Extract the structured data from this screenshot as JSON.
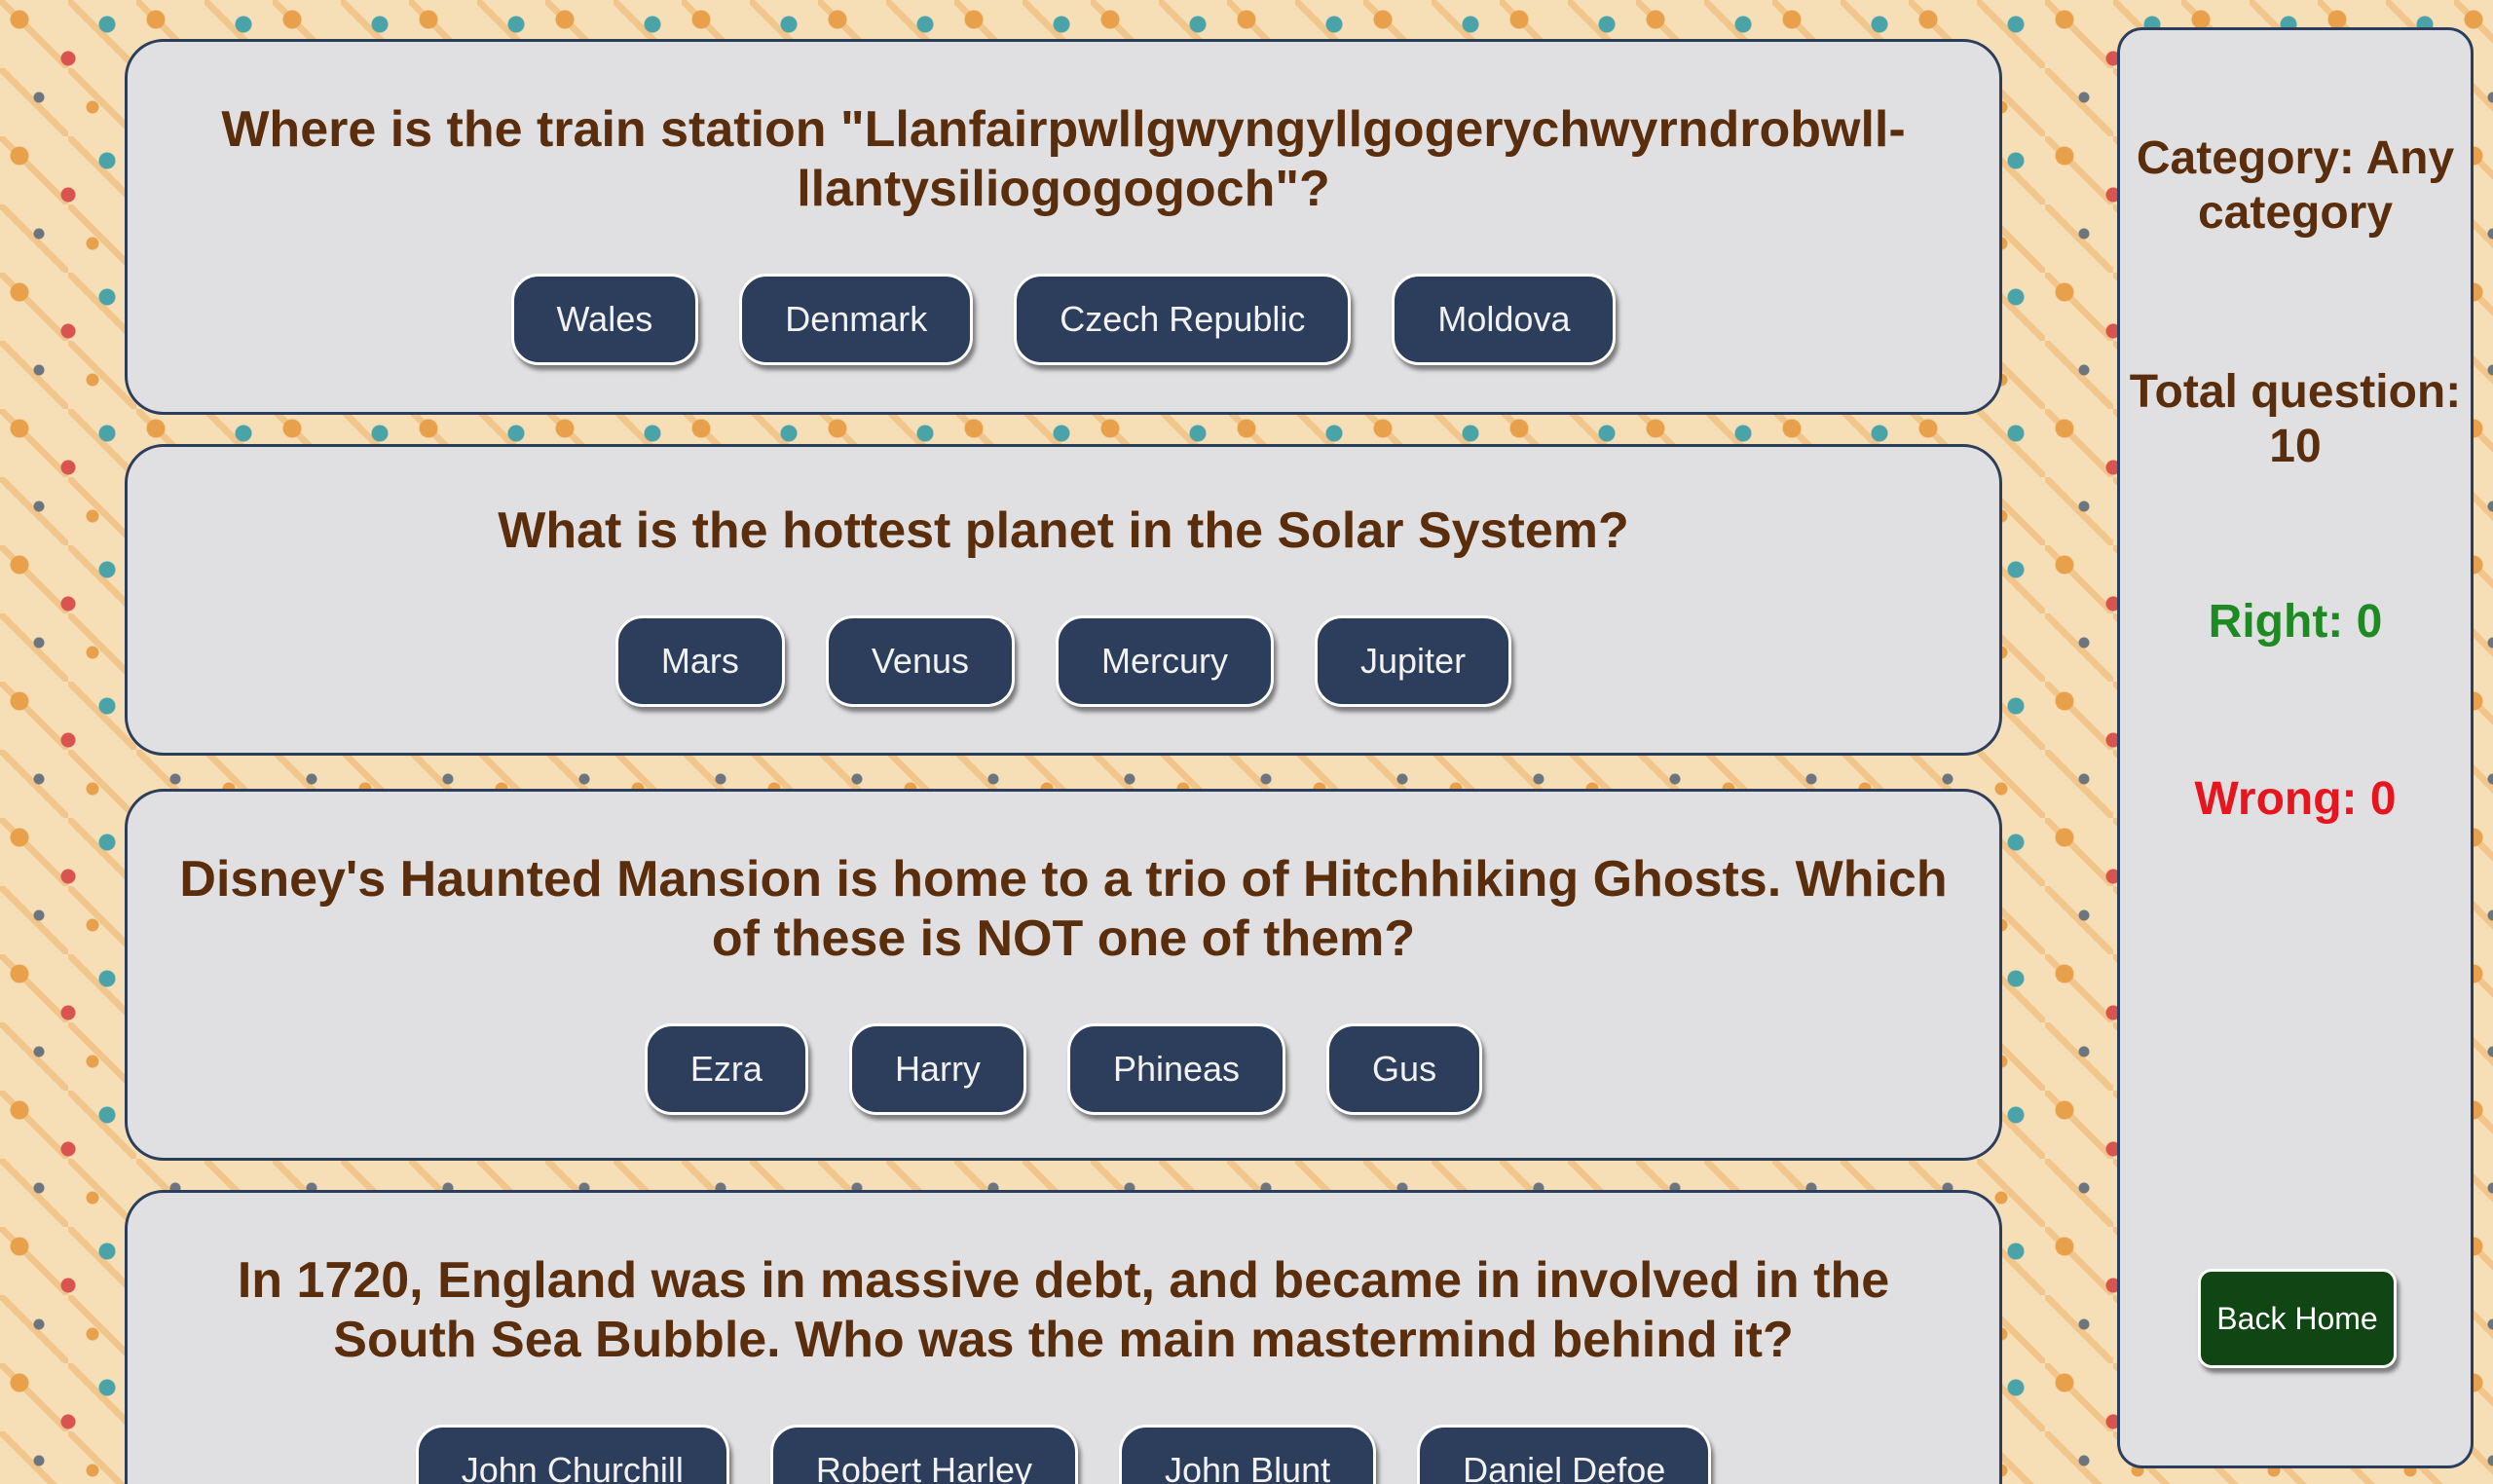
{
  "questions": [
    {
      "text": "Where is the train station \"Llanfairpwllgwyngyllgogerychwyrndrobwll-llantysiliogogogoch\"?",
      "answers": [
        "Wales",
        "Denmark",
        "Czech Republic",
        "Moldova"
      ]
    },
    {
      "text": "What is the hottest planet in the Solar System?",
      "answers": [
        "Mars",
        "Venus",
        "Mercury",
        "Jupiter"
      ]
    },
    {
      "text": "Disney's Haunted Mansion is home to a trio of Hitchhiking Ghosts. Which of these is NOT one of them?",
      "answers": [
        "Ezra",
        "Harry",
        "Phineas",
        "Gus"
      ]
    },
    {
      "text": "In 1720, England was in massive debt, and became in involved in the South Sea Bubble. Who was the main mastermind behind it?",
      "answers": [
        "John Churchill",
        "Robert Harley",
        "John Blunt",
        "Daniel Defoe"
      ]
    }
  ],
  "sidebar": {
    "category": "Category: Any category",
    "total": "Total question: 10",
    "right": "Right: 0",
    "wrong": "Wrong: 0",
    "back_home": "Back Home"
  },
  "colors": {
    "card_border": "#2c3e5c",
    "question_text": "#5a2e0c",
    "answer_button": "#2c3e5c",
    "right": "#1e8a22",
    "wrong": "#e8141e",
    "back_home_button": "#0f4614"
  }
}
